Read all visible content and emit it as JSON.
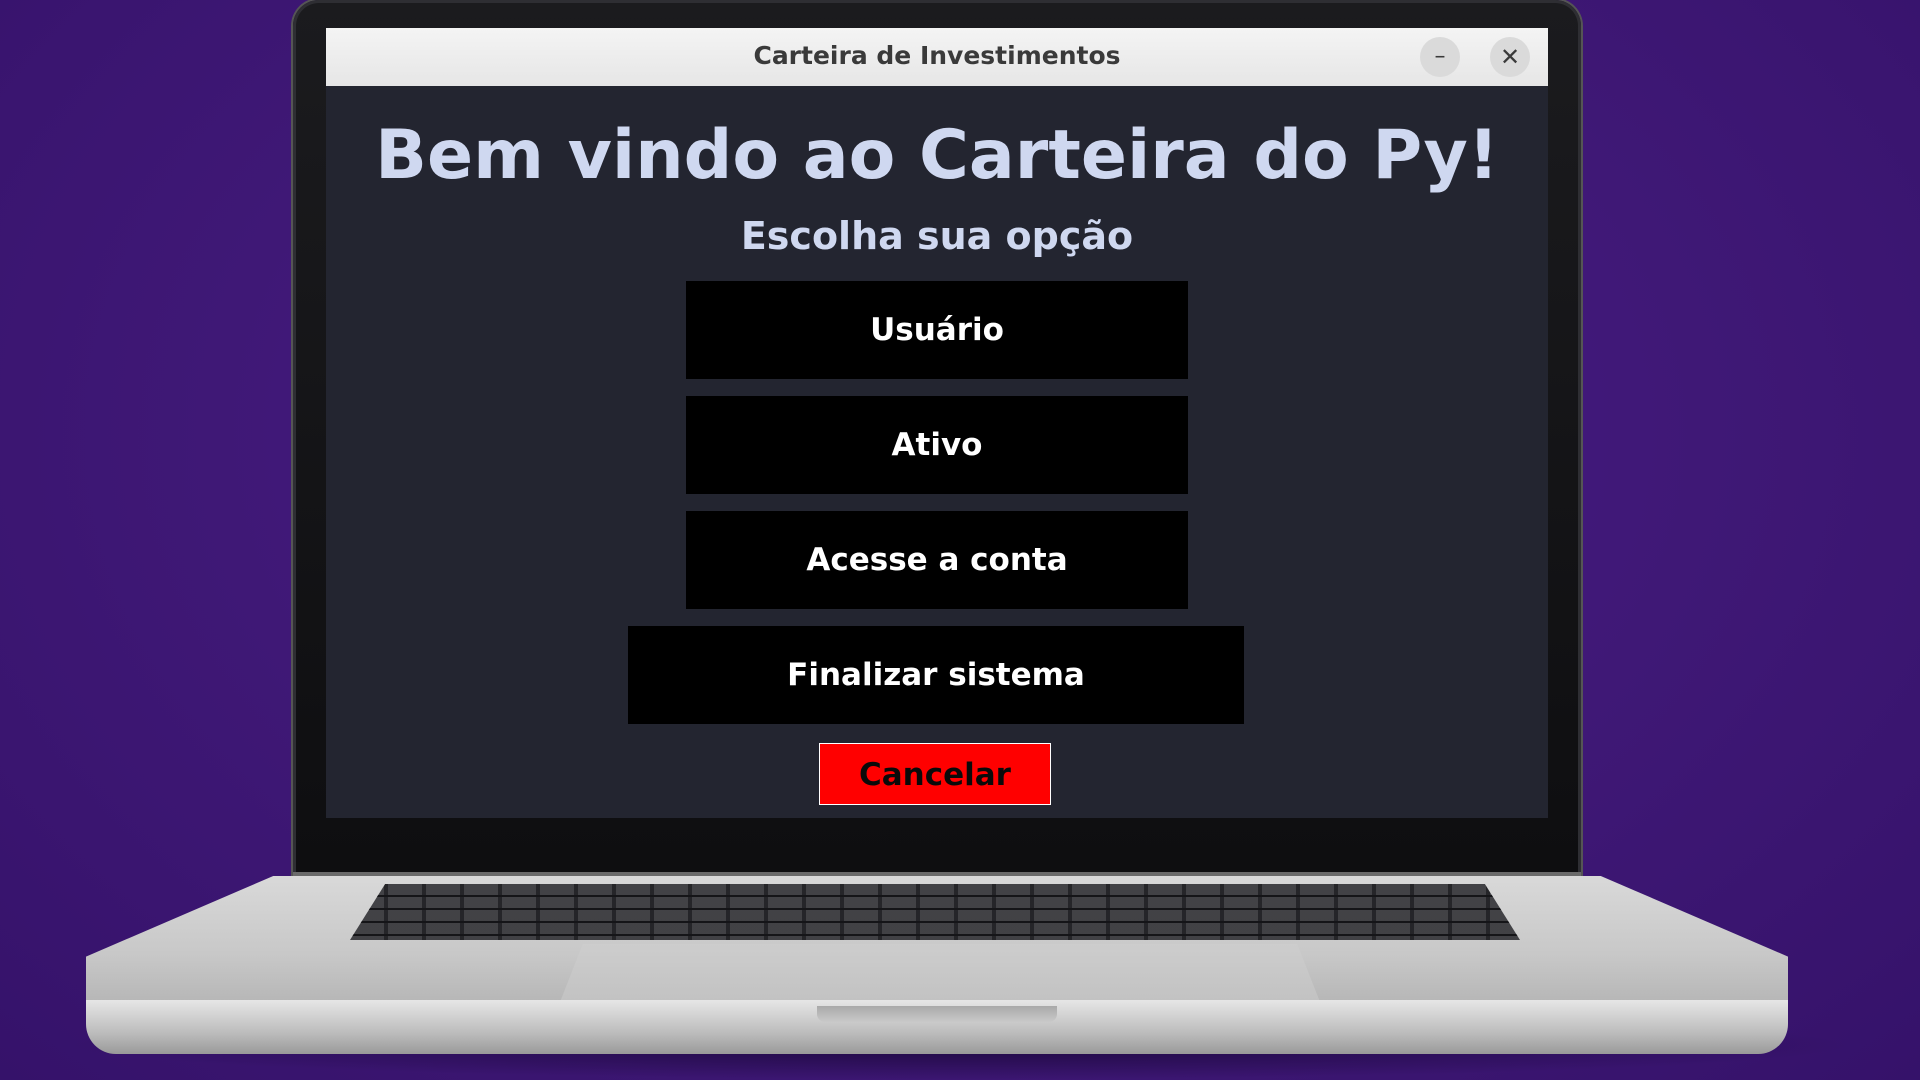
{
  "window": {
    "title": "Carteira de Investimentos",
    "minimize_symbol": "–",
    "close_symbol": "✕"
  },
  "main": {
    "welcome": "Bem vindo ao Carteira do Py!",
    "subtitle": "Escolha sua opção",
    "buttons": {
      "usuario": "Usuário",
      "ativo": "Ativo",
      "conta": "Acesse a conta",
      "finalizar": "Finalizar sistema",
      "cancelar": "Cancelar"
    }
  },
  "colors": {
    "background": "#3f1876",
    "window_bg": "#232530",
    "heading_text": "#cfd8f0",
    "button_bg": "#000000",
    "cancel_bg": "#ff0000"
  }
}
